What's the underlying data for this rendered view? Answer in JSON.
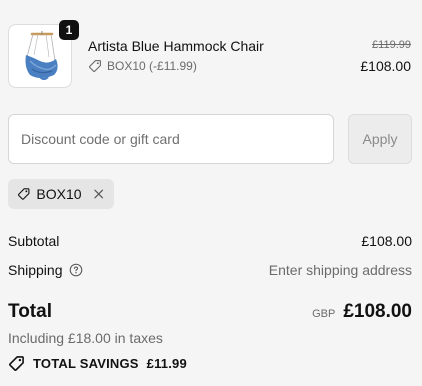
{
  "product": {
    "quantity": "1",
    "name": "Artista Blue Hammock Chair",
    "discount_line": "BOX10 (-£11.99)",
    "original_price": "£119.99",
    "discounted_price": "£108.00",
    "image_icon": "hammock-chair-image"
  },
  "discount_form": {
    "placeholder": "Discount code or gift card",
    "value": "",
    "apply_label": "Apply"
  },
  "applied_code": {
    "label": "BOX10",
    "icon": "tag-icon",
    "remove_icon": "close-icon"
  },
  "summary": {
    "subtotal_label": "Subtotal",
    "subtotal_value": "£108.00",
    "shipping_label": "Shipping",
    "shipping_value": "Enter shipping address",
    "total_label": "Total",
    "currency": "GBP",
    "total_value": "£108.00",
    "taxes_line": "Including £18.00 in taxes",
    "savings_label": "TOTAL SAVINGS",
    "savings_value": "£11.99"
  },
  "colors": {
    "background": "#f5f5f5",
    "text_primary": "#111111",
    "text_secondary": "#6b6b6b",
    "chip_background": "#e5e5e5",
    "product_blue": "#4a7fc1"
  }
}
